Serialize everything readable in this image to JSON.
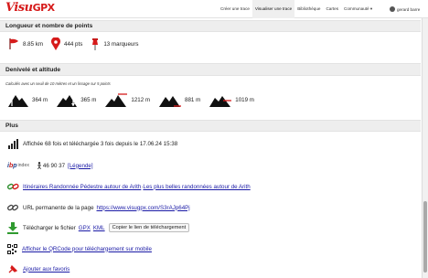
{
  "app": {
    "logo_main": "Visu",
    "logo_suffix": "GPX"
  },
  "nav": {
    "items": [
      {
        "label": "Créer une trace"
      },
      {
        "label": "Visualiser une trace"
      },
      {
        "label": "Bibliothèque"
      },
      {
        "label": "Cartes"
      },
      {
        "label": "Communauté ▾"
      }
    ],
    "user": "gerard barre"
  },
  "length_section": {
    "title": "Longueur et nombre de points",
    "distance": "8.85 km",
    "points": "444 pts",
    "markers": "13 marqueurs"
  },
  "elevation_section": {
    "title": "Denivelé et altitude",
    "note": "Calculés avec un seuil de 10 mètres et un lissage sur 5 points",
    "gain": "364 m",
    "loss": "365 m",
    "max_alt": "1212 m",
    "min_alt": "881 m",
    "mean_alt": "1019 m"
  },
  "more_section": {
    "title": "Plus",
    "stats_text": "Affichée 68 fois et téléchargée 3 fois depuis le 17.06.24 15:38",
    "ibp_logo": {
      "i": "i",
      "b": "b",
      "p": "p",
      "suffix": "index"
    },
    "ibp_values": "46 90 37",
    "ibp_legend": "[Légende]",
    "itineraries_link": "Itinéraires Randonnée Pédestre autour de Arith",
    "itineraries_sep": " · ",
    "best_link": "Les plus belles randonnées autour de Arith",
    "permalink_label": "URL permanente de la page",
    "permalink_url": "https://www.visugpx.com/S3rAJp64Pj",
    "download_label": "Télécharger le fichier",
    "download_gpx": "GPX",
    "download_kml": "KML",
    "copy_link_button": "Copier le lien de téléchargement",
    "qrcode_link": "Afficher le QRCode pour téléchargement sur mobile",
    "favorites_link": "Ajouter aux favoris"
  },
  "colors": {
    "accent": "#d61b1b",
    "link": "#1a1aa6",
    "header_bg": "#eeeeee"
  }
}
